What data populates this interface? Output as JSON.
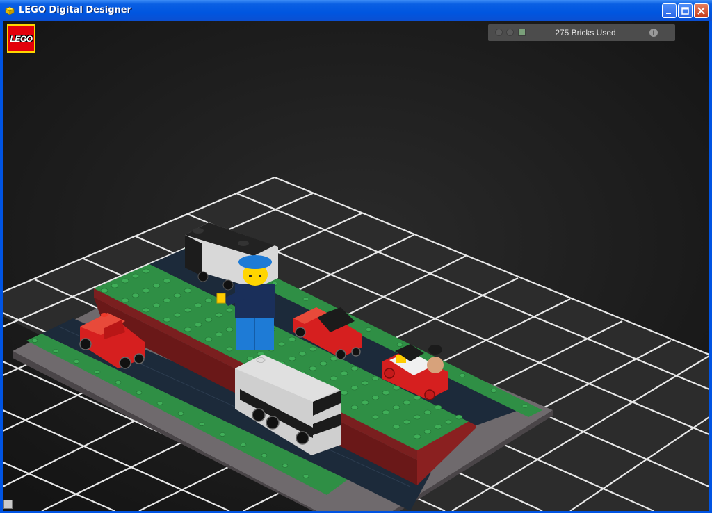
{
  "window": {
    "title": "LEGO Digital Designer",
    "controls": [
      "minimize",
      "maximize",
      "close"
    ]
  },
  "logo": {
    "text": "LEGO"
  },
  "stats_panel": {
    "bricks_used": "275 Bricks Used",
    "info_glyph": "i"
  },
  "colors": {
    "background": "#1d1d1d",
    "grid_lines": "#ffffff",
    "baseplate_green": "#2f8f45",
    "road": "#1c2a3a",
    "brick_red": "#d61f1f",
    "minifig_blue": "#1e7bd6",
    "title_bar": "#0a5fe3"
  },
  "scene": {
    "icons": [
      "lego-logo",
      "minifigure",
      "car",
      "bus",
      "ground-grid"
    ]
  }
}
